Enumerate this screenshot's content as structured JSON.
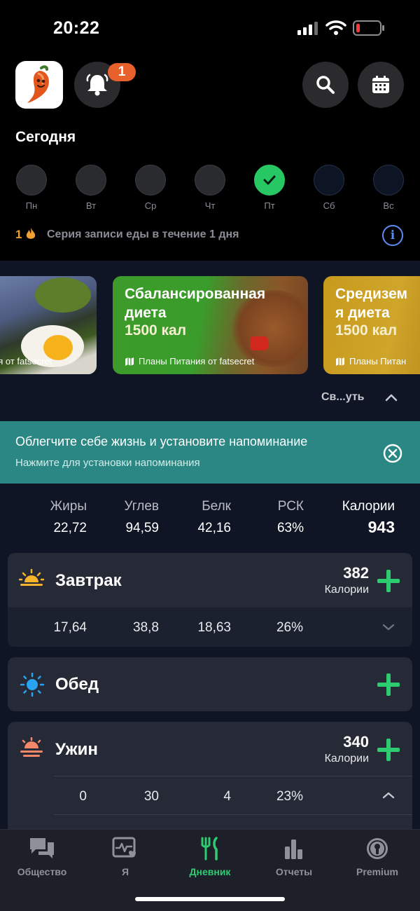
{
  "status_bar": {
    "time": "20:22"
  },
  "header": {
    "notification_count": "1",
    "today_label": "Сегодня"
  },
  "week": [
    {
      "label": "Пн",
      "state": "empty"
    },
    {
      "label": "Вт",
      "state": "empty"
    },
    {
      "label": "Ср",
      "state": "empty"
    },
    {
      "label": "Чт",
      "state": "empty"
    },
    {
      "label": "Пт",
      "state": "done"
    },
    {
      "label": "Сб",
      "state": "future"
    },
    {
      "label": "Вс",
      "state": "future"
    }
  ],
  "streak": {
    "count": "1",
    "text": "Серия записи еды в течение 1 дня"
  },
  "plans": [
    {
      "footer": "ия от fatsecret"
    },
    {
      "title_line1": "Сбалансированная",
      "title_line2": "диета",
      "kcal": "1500 кал",
      "footer": "Планы Питания от fatsecret"
    },
    {
      "title_line1": "Средизем",
      "title_line2": "я диета",
      "kcal": "1500 кал",
      "footer": "Планы Питан"
    }
  ],
  "collapse_label": "Св...уть",
  "reminder": {
    "title": "Облегчите себе жизнь и установите напоминание",
    "subtitle": "Нажмите для установки напоминания"
  },
  "summary": {
    "fat_label": "Жиры",
    "fat": "22,72",
    "carbs_label": "Углев",
    "carbs": "94,59",
    "protein_label": "Белк",
    "protein": "42,16",
    "rdi_label": "РСК",
    "rdi": "63%",
    "calories_label": "Калории",
    "calories": "943"
  },
  "meals": {
    "breakfast": {
      "name": "Завтрак",
      "calories": "382",
      "calories_label": "Калории",
      "fat": "17,64",
      "carbs": "38,8",
      "protein": "18,63",
      "rdi": "26%"
    },
    "lunch": {
      "name": "Обед"
    },
    "dinner": {
      "name": "Ужин",
      "calories": "340",
      "calories_label": "Калории",
      "fat": "0",
      "carbs": "30",
      "protein": "4",
      "rdi": "23%"
    }
  },
  "tabs": [
    {
      "label": "Общество",
      "icon": "chat-icon",
      "active": false
    },
    {
      "label": "Я",
      "icon": "heart-pulse-icon",
      "active": false
    },
    {
      "label": "Дневник",
      "icon": "fork-knife-icon",
      "active": true
    },
    {
      "label": "Отчеты",
      "icon": "bar-chart-icon",
      "active": false
    },
    {
      "label": "Premium",
      "icon": "premium-badge-icon",
      "active": false
    }
  ],
  "colors": {
    "accent_green": "#2ecc71",
    "reminder_bg": "#2a8783",
    "notification_badge": "#e8612c",
    "info_blue": "#5b8cf0"
  }
}
